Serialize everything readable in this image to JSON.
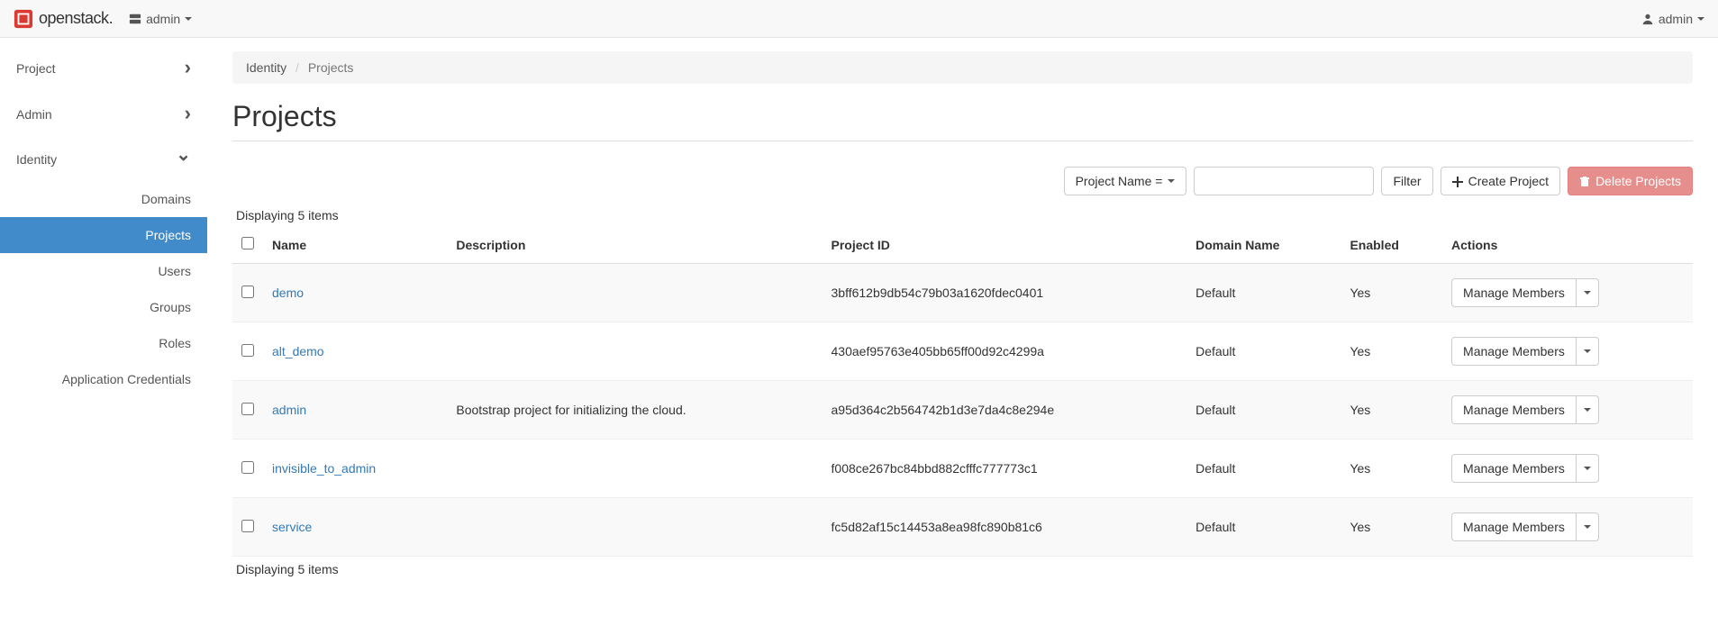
{
  "header": {
    "brand": "openstack",
    "domain_switch": "admin",
    "user_menu": "admin"
  },
  "sidebar": {
    "top": [
      {
        "label": "Project",
        "expanded": false
      },
      {
        "label": "Admin",
        "expanded": false
      },
      {
        "label": "Identity",
        "expanded": true
      }
    ],
    "identity_items": [
      {
        "label": "Domains",
        "active": false
      },
      {
        "label": "Projects",
        "active": true
      },
      {
        "label": "Users",
        "active": false
      },
      {
        "label": "Groups",
        "active": false
      },
      {
        "label": "Roles",
        "active": false
      },
      {
        "label": "Application Credentials",
        "active": false
      }
    ]
  },
  "breadcrumb": {
    "root": "Identity",
    "current": "Projects"
  },
  "page": {
    "title": "Projects",
    "count_label": "Displaying 5 items"
  },
  "toolbar": {
    "filter_field": "Project Name =",
    "search_placeholder": "",
    "filter_button": "Filter",
    "create_button": "Create Project",
    "delete_button": "Delete Projects"
  },
  "table": {
    "columns": {
      "name": "Name",
      "description": "Description",
      "project_id": "Project ID",
      "domain": "Domain Name",
      "enabled": "Enabled",
      "actions": "Actions"
    },
    "row_action_label": "Manage Members",
    "rows": [
      {
        "name": "demo",
        "description": "",
        "project_id": "3bff612b9db54c79b03a1620fdec0401",
        "domain": "Default",
        "enabled": "Yes"
      },
      {
        "name": "alt_demo",
        "description": "",
        "project_id": "430aef95763e405bb65ff00d92c4299a",
        "domain": "Default",
        "enabled": "Yes"
      },
      {
        "name": "admin",
        "description": "Bootstrap project for initializing the cloud.",
        "project_id": "a95d364c2b564742b1d3e7da4c8e294e",
        "domain": "Default",
        "enabled": "Yes"
      },
      {
        "name": "invisible_to_admin",
        "description": "",
        "project_id": "f008ce267bc84bbd882cfffc777773c1",
        "domain": "Default",
        "enabled": "Yes"
      },
      {
        "name": "service",
        "description": "",
        "project_id": "fc5d82af15c14453a8ea98fc890b81c6",
        "domain": "Default",
        "enabled": "Yes"
      }
    ]
  }
}
